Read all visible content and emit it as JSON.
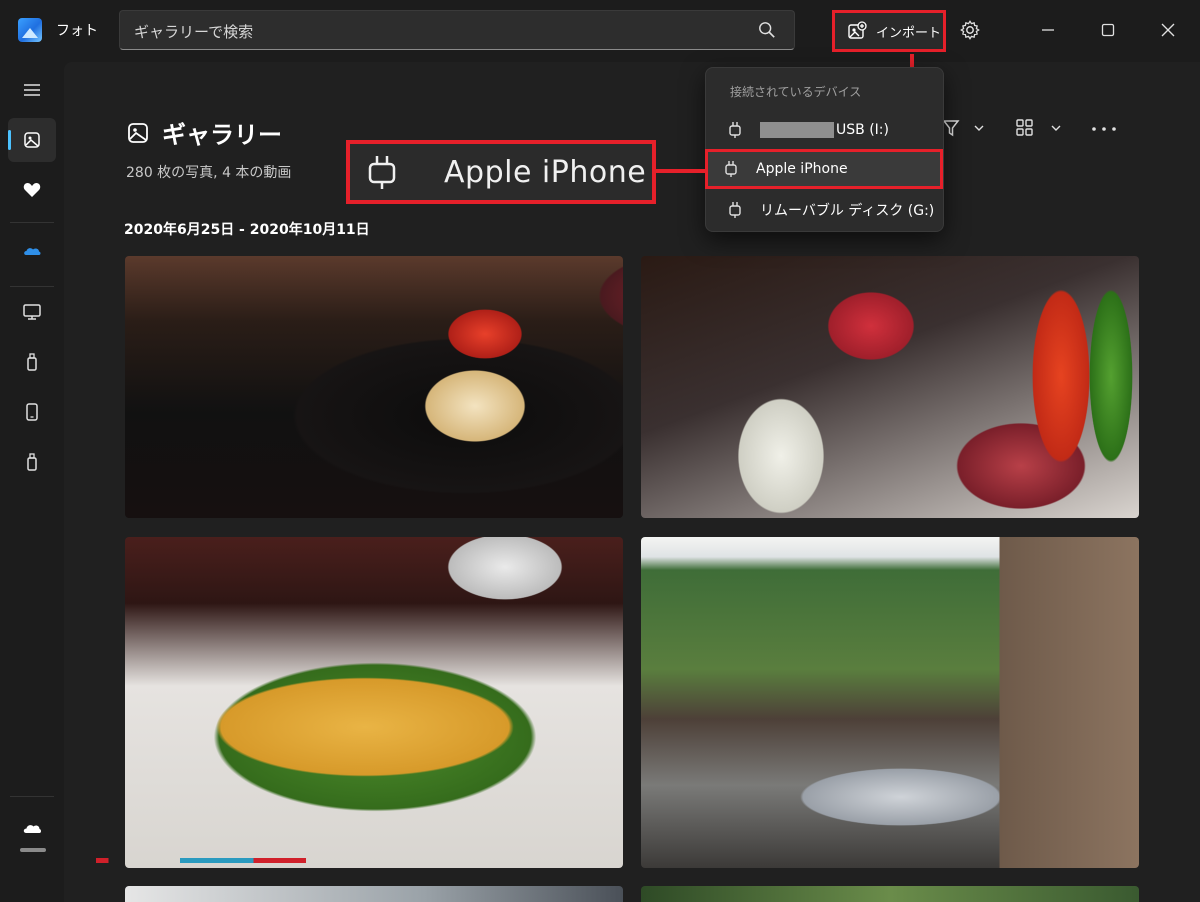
{
  "app": {
    "title": "フォト"
  },
  "search": {
    "text": "ギャラリーで検索"
  },
  "header": {
    "import_label": "インポート"
  },
  "sidebar": {
    "items": [
      {
        "name": "menu",
        "icon": "hamburger-icon"
      },
      {
        "name": "gallery",
        "icon": "gallery-icon",
        "active": true
      },
      {
        "name": "favorites",
        "icon": "heart-icon"
      },
      {
        "name": "onedrive",
        "icon": "onedrive-icon"
      },
      {
        "name": "this-pc",
        "icon": "monitor-icon"
      },
      {
        "name": "usb-drive-1",
        "icon": "usb-drive-icon"
      },
      {
        "name": "iphone",
        "icon": "phone-icon"
      },
      {
        "name": "usb-drive-2",
        "icon": "usb-drive-icon"
      },
      {
        "name": "cloud-status",
        "icon": "cloud-icon"
      }
    ]
  },
  "main": {
    "title": "ギャラリー",
    "subtitle": "280 枚の写真, 4 本の動画",
    "date_range": "2020年6月25日 - 2020年10月11日"
  },
  "import_menu": {
    "header": "接続されているデバイス",
    "items": [
      {
        "label": "USB (I:)",
        "redacted_prefix": true,
        "icon": "usb-plug-icon"
      },
      {
        "label": "Apple iPhone",
        "highlighted": true,
        "icon": "usb-plug-icon"
      },
      {
        "label": "リムーバブル ディスク (G:)",
        "icon": "usb-plug-icon"
      }
    ]
  },
  "callout": {
    "label": "Apple iPhone",
    "icon": "usb-plug-icon"
  },
  "colors": {
    "accent": "#4cc2ff",
    "highlight_red": "#e6202a",
    "background": "#202020"
  }
}
